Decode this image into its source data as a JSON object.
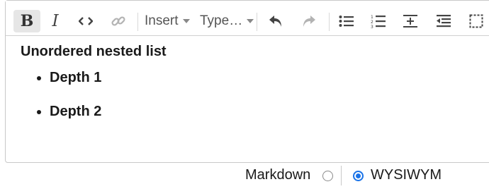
{
  "toolbar": {
    "insert_label": "Insert",
    "type_label": "Type…",
    "icons": [
      "bold-icon",
      "italic-icon",
      "code-icon",
      "link-icon",
      "undo-icon",
      "redo-icon",
      "bullet-list-icon",
      "numbered-list-icon",
      "horizontal-rule-icon",
      "outdent-icon",
      "select-block-icon"
    ]
  },
  "content": {
    "heading": "Unordered nested list",
    "items": [
      "Depth 1",
      "Depth 2"
    ]
  },
  "mode": {
    "markdown_label": "Markdown",
    "wysiwym_label": "WYSIWYM",
    "selected": "WYSIWYM"
  },
  "colors": {
    "accent": "#1a73e8",
    "active_button_bg": "#e6e6e6",
    "disabled_icon": "#b3b3b3"
  }
}
